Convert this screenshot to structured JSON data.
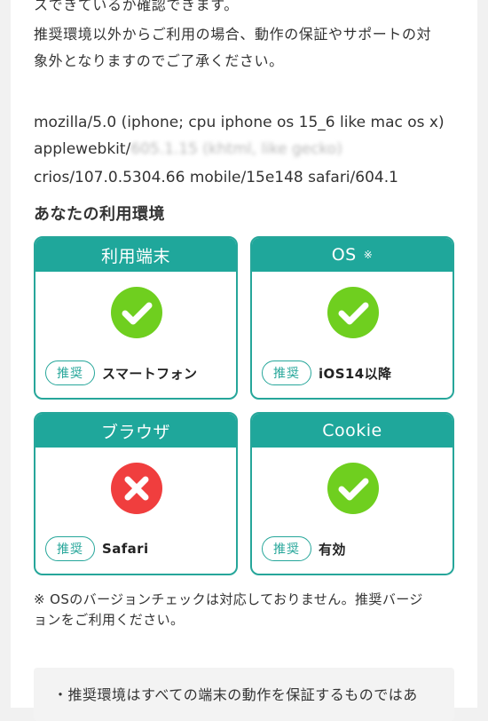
{
  "intro": {
    "line1": "スできているか確認できます。",
    "line2": "推奨環境以外からご利用の場合、動作の保証やサポートの対",
    "line3": "象外となりますのでご了承ください。"
  },
  "user_agent": {
    "line1": "mozilla/5.0 (iphone; cpu iphone os 15_6 like mac os x)",
    "line2_prefix": "applewebkit/",
    "line2_blurred": "605.1.15 (khtml, like gecko)",
    "line3": "crios/107.0.5304.66 mobile/15e148 safari/604.1"
  },
  "section_title": "あなたの利用環境",
  "cards": [
    {
      "title": "利用端末",
      "mark": "",
      "status": "ok",
      "badge": "推奨",
      "value": "スマートフォン"
    },
    {
      "title": "OS",
      "mark": "※",
      "status": "ok",
      "badge": "推奨",
      "value": "iOS14以降"
    },
    {
      "title": "ブラウザ",
      "mark": "",
      "status": "ng",
      "badge": "推奨",
      "value": "Safari"
    },
    {
      "title": "Cookie",
      "mark": "",
      "status": "ok",
      "badge": "推奨",
      "value": "有効"
    }
  ],
  "note": {
    "line1": "※ OSのバージョンチェックは対応しておりません。推奨バージ",
    "line2": "ョンをご利用ください。"
  },
  "disclaimer": {
    "line1": "・推奨環境はすべての端末の動作を保証するものではあ"
  },
  "colors": {
    "teal": "#1fa79b",
    "ok_green": "#6fcf1f",
    "ng_red": "#f03e3e"
  },
  "icons": {
    "ok": "check-circle-icon",
    "ng": "cross-circle-icon"
  }
}
